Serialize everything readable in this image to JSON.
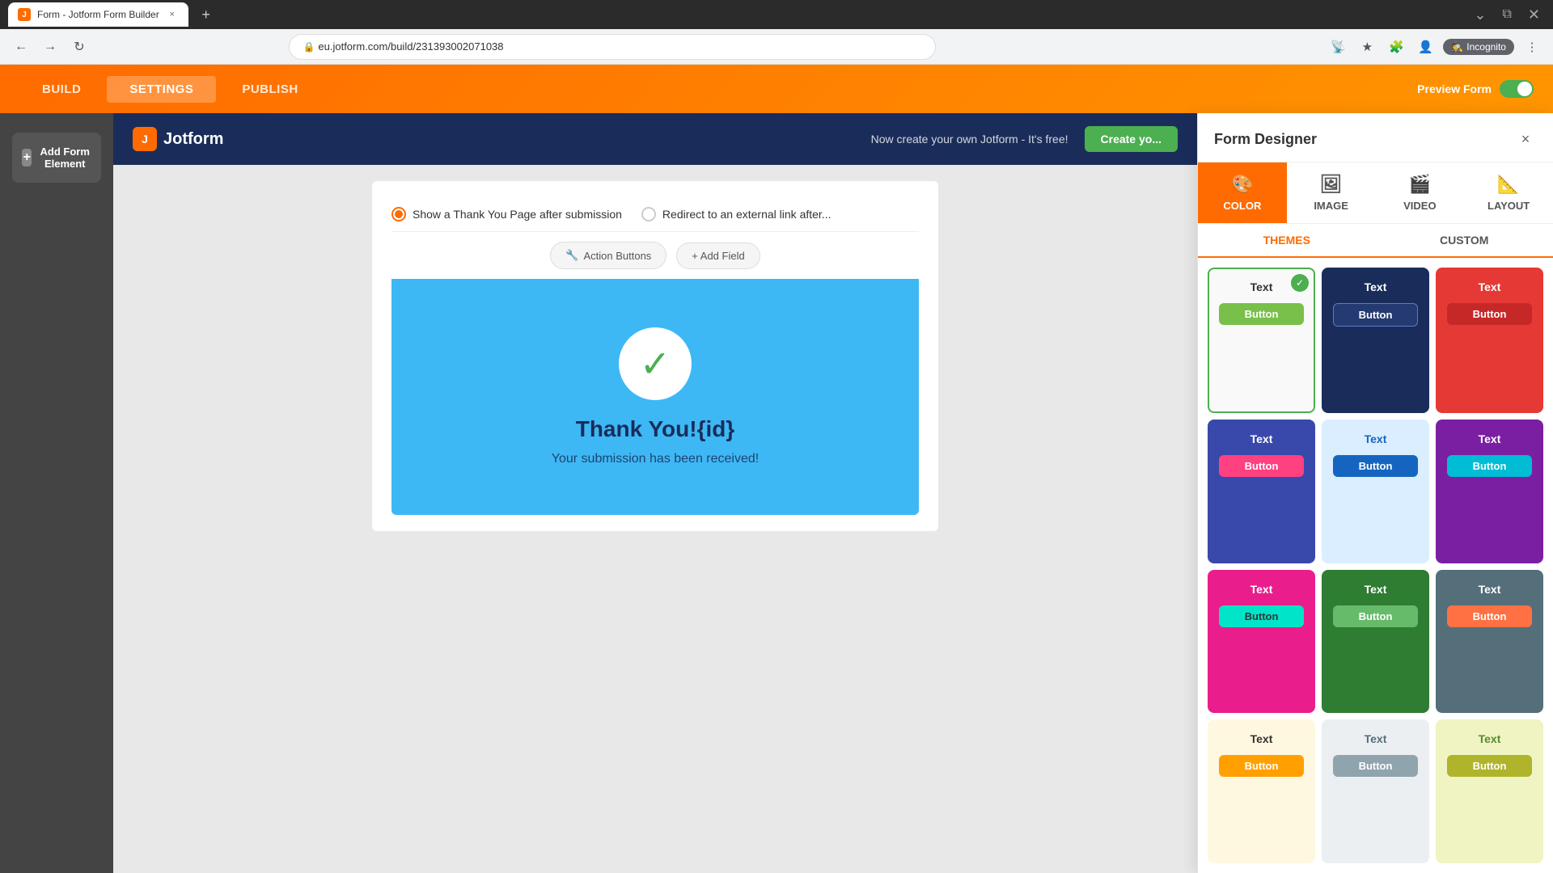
{
  "browser": {
    "tab_title": "Form - Jotform Form Builder",
    "url": "eu.jotform.com/build/231393002071038",
    "incognito_label": "Incognito"
  },
  "app": {
    "nav_items": [
      "BUILD",
      "SETTINGS",
      "PUBLISH"
    ],
    "active_nav": "BUILD",
    "preview_label": "Preview Form"
  },
  "sidebar": {
    "add_element_label": "Add Form Element"
  },
  "banner": {
    "logo_text": "Jotform",
    "promo_text": "Now create your own Jotform - It's free!",
    "cta_label": "Create yo..."
  },
  "form": {
    "radio1_label": "Show a Thank You Page after submission",
    "radio2_label": "Redirect to an external link after...",
    "action_buttons_label": "Action Buttons",
    "add_field_label": "+ Add Field",
    "thank_you_title": "Thank You!{id}",
    "thank_you_sub": "Your submission has been received!"
  },
  "designer_panel": {
    "title": "Form Designer",
    "close_label": "×",
    "tabs1": [
      {
        "id": "color",
        "label": "COLOR",
        "icon": "🎨"
      },
      {
        "id": "image",
        "label": "IMAGE",
        "icon": "🖼"
      },
      {
        "id": "video",
        "label": "VIDEO",
        "icon": "🎬"
      },
      {
        "id": "layout",
        "label": "LAYOUT",
        "icon": "📐"
      }
    ],
    "tabs2": [
      "THEMES",
      "CUSTOM"
    ],
    "active_tab1": "color",
    "active_tab2": "THEMES",
    "themes": [
      {
        "id": "white",
        "text_label": "Text",
        "button_label": "Button",
        "text_color": "#333",
        "bg": "#f9f9f9",
        "btn_bg": "#78c04a",
        "btn_color": "#fff",
        "selected": true
      },
      {
        "id": "navy",
        "text_label": "Text",
        "button_label": "Button",
        "text_color": "#fff",
        "bg": "#1a2d5a",
        "btn_bg": "#2a3f7a",
        "btn_color": "#fff",
        "selected": false
      },
      {
        "id": "red",
        "text_label": "Text",
        "button_label": "Button",
        "text_color": "#fff",
        "bg": "#e53935",
        "btn_bg": "#e53935",
        "btn_color": "#fff",
        "selected": false
      },
      {
        "id": "indigo",
        "text_label": "Text",
        "button_label": "Button",
        "text_color": "#fff",
        "bg": "#3949ab",
        "btn_bg": "#ff4081",
        "btn_color": "#fff",
        "selected": false
      },
      {
        "id": "light-blue",
        "text_label": "Text",
        "button_label": "Button",
        "text_color": "#1565c0",
        "bg": "#e3f2fd",
        "btn_bg": "#1565c0",
        "btn_color": "#fff",
        "selected": false
      },
      {
        "id": "purple",
        "text_label": "Text",
        "button_label": "Button",
        "text_color": "#fff",
        "bg": "#7b1fa2",
        "btn_bg": "#00bcd4",
        "btn_color": "#fff",
        "selected": false
      },
      {
        "id": "magenta",
        "text_label": "Text",
        "button_label": "Button",
        "text_color": "#fff",
        "bg": "#e91e8c",
        "btn_bg": "#00e5c9",
        "btn_color": "#333",
        "selected": false
      },
      {
        "id": "green",
        "text_label": "Text",
        "button_label": "Button",
        "text_color": "#fff",
        "bg": "#2e7d32",
        "btn_bg": "#66bb6a",
        "btn_color": "#fff",
        "selected": false
      },
      {
        "id": "gray",
        "text_label": "Text",
        "button_label": "Button",
        "text_color": "#fff",
        "bg": "#546e7a",
        "btn_bg": "#ff7043",
        "btn_color": "#fff",
        "selected": false
      },
      {
        "id": "row4-1",
        "text_label": "Text",
        "button_label": "Button",
        "text_color": "#333",
        "bg": "#fff8e1",
        "btn_bg": "#ffa000",
        "btn_color": "#fff",
        "selected": false
      },
      {
        "id": "row4-2",
        "text_label": "Text",
        "button_label": "Button",
        "text_color": "#555",
        "bg": "#f5f5f5",
        "btn_bg": "#bdbdbd",
        "btn_color": "#fff",
        "selected": false
      },
      {
        "id": "row4-3",
        "text_label": "Text",
        "button_label": "Button",
        "text_color": "#fff",
        "bg": "#cddc39",
        "btn_bg": "#afb42b",
        "btn_color": "#fff",
        "selected": false
      }
    ]
  }
}
